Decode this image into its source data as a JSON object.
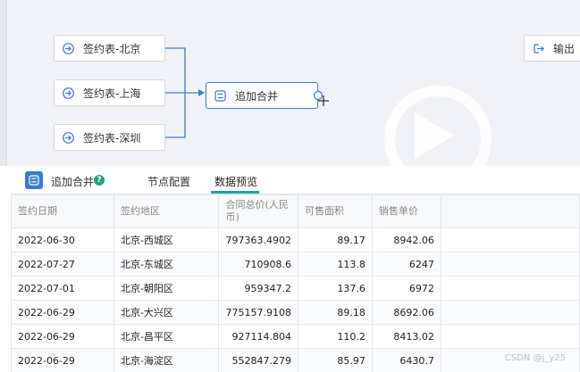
{
  "canvas": {
    "nodes": [
      {
        "label": "签约表-北京",
        "icon": "input-icon"
      },
      {
        "label": "签约表-上海",
        "icon": "input-icon"
      },
      {
        "label": "签约表-深圳",
        "icon": "input-icon"
      },
      {
        "label": "追加合并",
        "icon": "merge-icon"
      },
      {
        "label": "输出",
        "icon": "output-icon"
      }
    ]
  },
  "panel": {
    "title": "追加合并",
    "help": "?",
    "tabs": [
      {
        "label": "节点配置",
        "active": false
      },
      {
        "label": "数据预览",
        "active": true
      }
    ],
    "accent": "#1fa5a0"
  },
  "table": {
    "columns": [
      "签约日期",
      "签约地区",
      "合同总价(人民币)",
      "可售面积",
      "销售单价",
      ""
    ],
    "rows": [
      [
        "2022-06-30",
        "北京-西城区",
        "797363.4902",
        "89.17",
        "8942.06"
      ],
      [
        "2022-07-27",
        "北京-东城区",
        "710908.6",
        "113.8",
        "6247"
      ],
      [
        "2022-07-01",
        "北京-朝阳区",
        "959347.2",
        "137.6",
        "6972"
      ],
      [
        "2022-06-29",
        "北京-大兴区",
        "775157.9108",
        "89.18",
        "8692.06"
      ],
      [
        "2022-06-29",
        "北京-昌平区",
        "927114.804",
        "110.2",
        "8413.02"
      ],
      [
        "2022-06-29",
        "北京-海淀区",
        "552847.279",
        "85.97",
        "6430.7"
      ]
    ]
  },
  "watermark": "CSDN @j_y25"
}
